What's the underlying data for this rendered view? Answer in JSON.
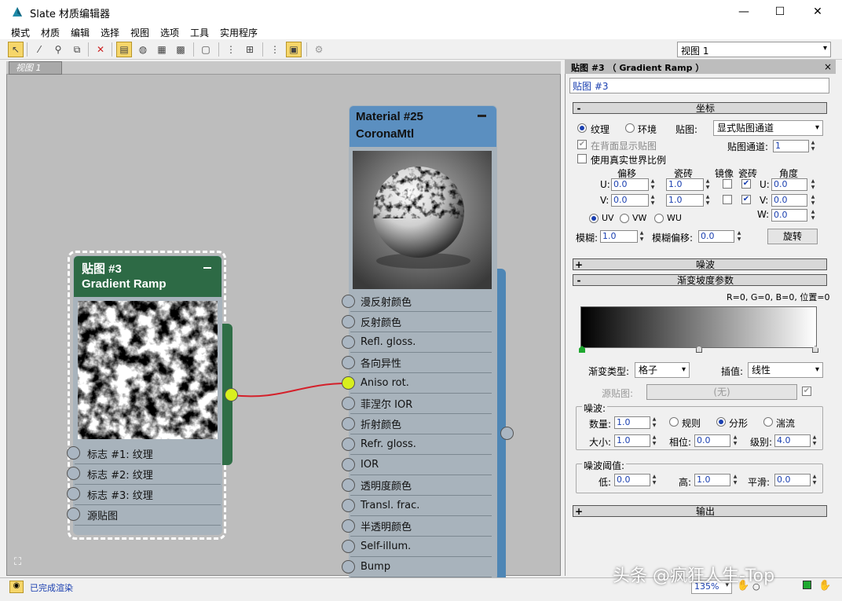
{
  "window": {
    "title": "Slate 材质编辑器",
    "minimize": "—",
    "maximize": "☐",
    "close": "✕"
  },
  "menu": [
    "模式",
    "材质",
    "编辑",
    "选择",
    "视图",
    "选项",
    "工具",
    "实用程序"
  ],
  "toolbar": {
    "view_select": "视图 1"
  },
  "canvas": {
    "tab_label": "视图 1"
  },
  "node_map": {
    "title": "贴图 #3",
    "subtitle": "Gradient Ramp",
    "slots": [
      "标志 #1: 纹理",
      "标志 #2: 纹理",
      "标志 #3: 纹理",
      "源贴图"
    ]
  },
  "node_material": {
    "title": "Material #25",
    "subtitle": "CoronaMtl",
    "slots": [
      "漫反射颜色",
      "反射颜色",
      "Refl. gloss.",
      "各向异性",
      "Aniso rot.",
      "菲涅尔 IOR",
      "折射颜色",
      "Refr. gloss.",
      "IOR",
      "透明度颜色",
      "Transl. frac.",
      "半透明颜色",
      "Self-illum.",
      "Bump"
    ]
  },
  "panel": {
    "header": "贴图 #3 （ Gradient Ramp ）",
    "name_field": "贴图 #3",
    "coords": {
      "rollout": "坐标",
      "texture": "纹理",
      "environ": "环境",
      "map_label": "贴图:",
      "map_value": "显式贴图通道",
      "show_back": "在背面显示贴图",
      "map_channel_label": "贴图通道:",
      "map_channel": "1",
      "real_world": "使用真实世界比例",
      "offset": "偏移",
      "tiling": "瓷砖",
      "mirror": "镜像",
      "tile": "瓷砖",
      "angle": "角度",
      "u": "U:",
      "v": "V:",
      "w": "W:",
      "u_offset": "0.0",
      "v_offset": "0.0",
      "u_tiling": "1.0",
      "v_tiling": "1.0",
      "u_angle": "0.0",
      "v_angle": "0.0",
      "w_angle": "0.0",
      "uv": "UV",
      "vw": "VW",
      "wu": "WU",
      "blur_label": "模糊:",
      "blur": "1.0",
      "blur_offset_label": "模糊偏移:",
      "blur_offset": "0.0",
      "rotate": "旋转"
    },
    "noise_rollout": "噪波",
    "gradient": {
      "rollout": "渐变坡度参数",
      "readout": "R=0, G=0, B=0, 位置=0",
      "type_label": "渐变类型:",
      "type_value": "格子",
      "interp_label": "插值:",
      "interp_value": "线性",
      "source_label": "源贴图:",
      "source_value": "(无)",
      "noise_group": "噪波:",
      "amount_label": "数量:",
      "amount": "1.0",
      "regular": "规则",
      "fractal": "分形",
      "turbulence": "湍流",
      "size_label": "大小:",
      "size": "1.0",
      "phase_label": "相位:",
      "phase": "0.0",
      "levels_label": "级别:",
      "levels": "4.0",
      "threshold_group": "噪波阈值:",
      "low_label": "低:",
      "low": "0.0",
      "high_label": "高:",
      "high": "1.0",
      "smooth_label": "平滑:",
      "smooth": "0.0"
    },
    "output_rollout": "输出"
  },
  "status": {
    "text": "已完成渲染",
    "zoom": "135%"
  },
  "watermark": "头条 @疯狂人生-Top"
}
